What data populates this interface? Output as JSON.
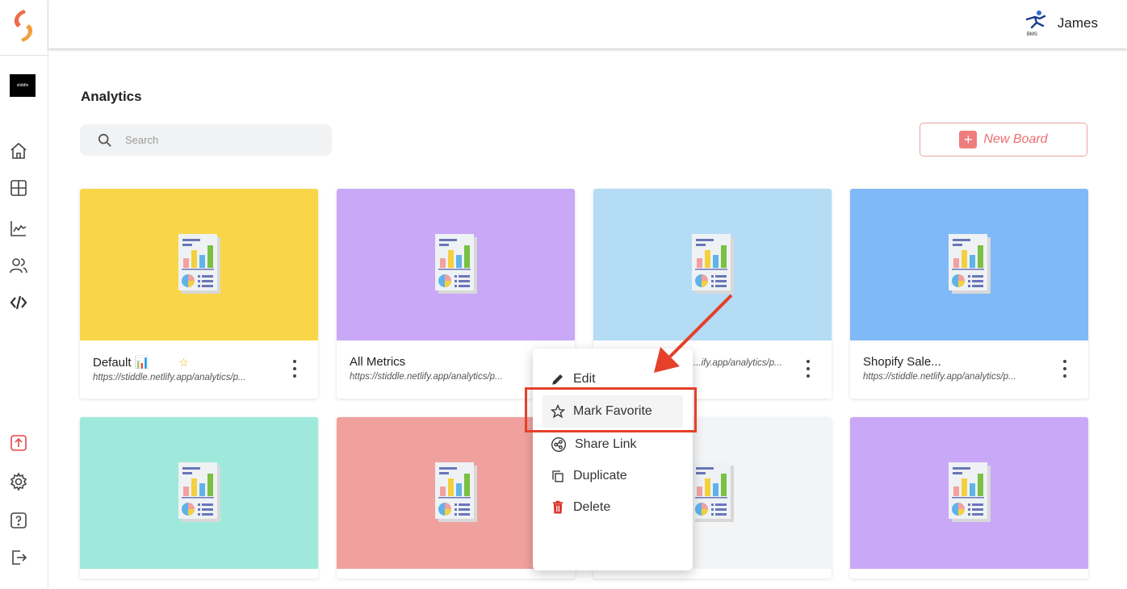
{
  "app": {
    "org_label": "stiddle"
  },
  "user": {
    "name": "James",
    "badge": "BMS"
  },
  "page": {
    "title": "Analytics"
  },
  "search": {
    "placeholder": "Search"
  },
  "toolbar": {
    "new_board_label": "New Board"
  },
  "cards": [
    {
      "title": "Default 📊",
      "url": "https://stiddle.netlify.app/analytics/p...",
      "color": "#f8d648",
      "favorite": true
    },
    {
      "title": "All Metrics",
      "url": "https://stiddle.netlify.app/analytics/p...",
      "color": "#c9a8f7"
    },
    {
      "title": "",
      "url": "...ify.app/analytics/p...",
      "color": "#b4dcf5"
    },
    {
      "title": "Shopify Sale...",
      "url": "https://stiddle.netlify.app/analytics/p...",
      "color": "#7fb9f7"
    },
    {
      "color": "#9fe9dc"
    },
    {
      "color": "#f0a19e"
    },
    {
      "color": "#f3f4f6"
    },
    {
      "color": "#c9a8f7"
    }
  ],
  "context_menu": {
    "items": [
      {
        "label": "Edit",
        "icon": "pencil-icon"
      },
      {
        "label": "Mark Favorite",
        "icon": "star-outline-icon"
      },
      {
        "label": "Share Link",
        "icon": "share-icon"
      },
      {
        "label": "Duplicate",
        "icon": "duplicate-icon"
      },
      {
        "label": "Delete",
        "icon": "trash-icon"
      }
    ]
  },
  "colors": {
    "accent": "#ec6d6d",
    "annotation": "#e5402a"
  }
}
